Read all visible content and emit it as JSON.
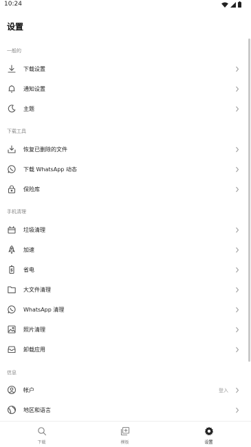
{
  "status_bar": {
    "time": "10:24"
  },
  "header": {
    "title": "设置"
  },
  "sections": {
    "general": {
      "title": "一般的",
      "items": [
        {
          "label": "下载设置",
          "icon": "download-icon"
        },
        {
          "label": "通知设置",
          "icon": "bell-icon"
        },
        {
          "label": "主题",
          "icon": "moon-icon"
        }
      ]
    },
    "download_tools": {
      "title": "下载工具",
      "items": [
        {
          "label": "恢复已删除的文件",
          "icon": "restore-download-icon"
        },
        {
          "label": "下载 WhatsApp 动态",
          "icon": "whatsapp-icon"
        },
        {
          "label": "保险库",
          "icon": "lock-icon"
        }
      ]
    },
    "phone_cleanup": {
      "title": "手机清理",
      "items": [
        {
          "label": "垃圾清理",
          "icon": "trash-box-icon"
        },
        {
          "label": "加速",
          "icon": "rocket-icon"
        },
        {
          "label": "省电",
          "icon": "battery-icon"
        },
        {
          "label": "大文件清理",
          "icon": "folder-icon"
        },
        {
          "label": "WhatsApp 清理",
          "icon": "whatsapp-icon"
        },
        {
          "label": "照片清理",
          "icon": "image-icon"
        },
        {
          "label": "卸载应用",
          "icon": "uninstall-icon"
        }
      ]
    },
    "info": {
      "title": "信息",
      "items": [
        {
          "label": "帐户",
          "icon": "account-icon",
          "extra": "登入"
        },
        {
          "label": "地区和语言",
          "icon": "globe-icon"
        }
      ]
    }
  },
  "bottom_nav": [
    {
      "label": "下载",
      "icon": "search-icon",
      "active": false
    },
    {
      "label": "模板",
      "icon": "media-add-icon",
      "active": false
    },
    {
      "label": "设置",
      "icon": "settings-icon",
      "active": true
    }
  ]
}
